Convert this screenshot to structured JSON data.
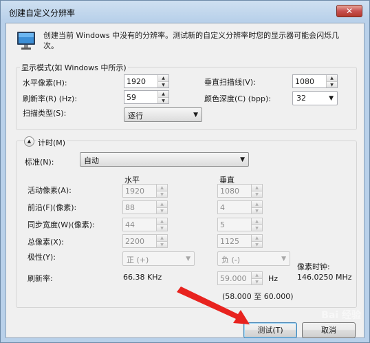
{
  "window": {
    "title": "创建自定义分辨率",
    "close_label": "✕"
  },
  "intro": {
    "text": "创建当前 Windows 中没有的分辨率。测试新的自定义分辨率时您的显示器可能会闪烁几次。"
  },
  "display_mode": {
    "group_label": "显示模式(如 Windows 中所示)",
    "horizontal_pixels_label": "水平像素(H):",
    "horizontal_pixels_value": "1920",
    "vertical_lines_label": "垂直扫描线(V):",
    "vertical_lines_value": "1080",
    "refresh_rate_label": "刷新率(R) (Hz):",
    "refresh_rate_value": "59",
    "color_depth_label": "颜色深度(C) (bpp):",
    "color_depth_value": "32",
    "scan_type_label": "扫描类型(S):",
    "scan_type_value": "逐行"
  },
  "timing": {
    "group_label": "计时(M)",
    "standard_label": "标准(N):",
    "standard_value": "自动",
    "col_horizontal": "水平",
    "col_vertical": "垂直",
    "active_pixels_label": "活动像素(A):",
    "active_pixels_h": "1920",
    "active_pixels_v": "1080",
    "front_porch_label": "前沿(F)(像素):",
    "front_porch_h": "88",
    "front_porch_v": "4",
    "sync_width_label": "同步宽度(W)(像素):",
    "sync_width_h": "44",
    "sync_width_v": "5",
    "total_pixels_label": "总像素(X):",
    "total_pixels_h": "2200",
    "total_pixels_v": "1125",
    "polarity_label": "极性(Y):",
    "polarity_h": "正 (+)",
    "polarity_v": "负 (-)",
    "pixel_clock_label": "像素时钟:",
    "pixel_clock_value": "146.0250 MHz",
    "refresh_label": "刷新率:",
    "refresh_h_value": "66.38 KHz",
    "refresh_v_value": "59.000",
    "refresh_v_unit": "Hz",
    "refresh_range": "(58.000 至 60.000)"
  },
  "buttons": {
    "test_label": "测试(T)",
    "cancel_label": "取消"
  },
  "colors": {
    "annotation_arrow": "#e8231f"
  },
  "watermark": "Bai 经验"
}
